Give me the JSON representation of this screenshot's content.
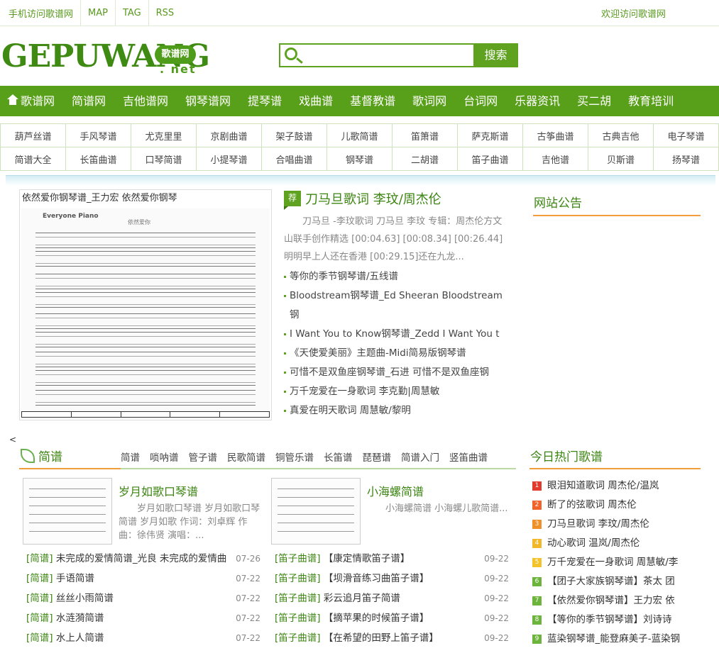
{
  "topbar": {
    "links": [
      "手机访问歌谱网",
      "MAP",
      "TAG",
      "RSS"
    ],
    "welcome": "欢迎访问歌谱网"
  },
  "logo": {
    "letters": "GEPUWANG",
    "badge": "歌谱网",
    "suffix": ". net"
  },
  "search": {
    "placeholder": "",
    "button": "搜索"
  },
  "nav": [
    "歌谱网",
    "简谱网",
    "吉他谱网",
    "钢琴谱网",
    "提琴谱",
    "戏曲谱",
    "基督教谱",
    "歌词网",
    "台词网",
    "乐器资讯",
    "买二胡",
    "教育培训"
  ],
  "subnav": [
    [
      "葫芦丝谱",
      "手风琴谱",
      "尤克里里",
      "京剧曲谱",
      "架子鼓谱",
      "儿歌简谱",
      "笛箫谱",
      "萨克斯谱",
      "古筝曲谱",
      "古典吉他",
      "电子琴谱"
    ],
    [
      "简谱大全",
      "长笛曲谱",
      "口琴简谱",
      "小提琴谱",
      "合唱曲谱",
      "钢琴谱",
      "二胡谱",
      "笛子曲谱",
      "吉他谱",
      "贝斯谱",
      "扬琴谱"
    ]
  ],
  "featured": {
    "caption": "依然爱你钢琴谱_王力宏 依然爱你钢琴",
    "sheet_title": "Everyone Piano",
    "sheet_sub": "依然爱你"
  },
  "lead": {
    "badge": "荐",
    "title": "刀马旦歌词 李玟/周杰伦",
    "desc": "刀马旦 -李玟歌词 刀马旦 李玟 专辑：周杰伦方文山联手创作精选 [00:04.63] [00:08.34] [00:26.44] 明明早上人还在香港 [00:29.15]还在九龙...",
    "items": [
      "等你的季节钢琴谱/五线谱",
      "Bloodstream钢琴谱_Ed Sheeran Bloodstream钢",
      "I Want You to Know钢琴谱_Zedd I Want You t",
      "《天使爱美丽》主题曲-Midi简易版钢琴谱",
      "可惜不是双鱼座钢琴谱_石进 可惜不是双鱼座钢",
      "万千宠爱在一身歌词 李克勤|周慧敏",
      "真爱在明天歌词 周慧敏/黎明"
    ]
  },
  "notice": {
    "title": "网站公告"
  },
  "stray": "<",
  "jianpu": {
    "title": "简谱",
    "tabs": [
      "简谱",
      "唢呐谱",
      "管子谱",
      "民歌简谱",
      "铜管乐谱",
      "长笛谱",
      "琵琶谱",
      "简谱入门",
      "竖笛曲谱"
    ],
    "cards": [
      {
        "title": "岁月如歌口琴谱",
        "desc": "岁月如歌口琴谱 岁月如歌口琴简谱 岁月如歌 作词：刘卓辉 作曲：徐伟贤 演唱：..."
      },
      {
        "title": "小海螺简谱",
        "desc": "小海螺简谱 小海螺儿歌简谱..."
      }
    ],
    "left_list": [
      {
        "cat": "[简谱]",
        "text": "未完成的爱情简谱_光良 未完成的爱情曲",
        "date": "07-26"
      },
      {
        "cat": "[简谱]",
        "text": "手语简谱",
        "date": "07-22"
      },
      {
        "cat": "[简谱]",
        "text": "丝丝小雨简谱",
        "date": "07-22"
      },
      {
        "cat": "[简谱]",
        "text": "水涟漪简谱",
        "date": "07-22"
      },
      {
        "cat": "[简谱]",
        "text": "水上人简谱",
        "date": "07-22"
      }
    ],
    "right_list": [
      {
        "cat": "[笛子曲谱]",
        "text": "【康定情歌笛子谱】",
        "date": "09-22"
      },
      {
        "cat": "[笛子曲谱]",
        "text": "【坝滑音练习曲笛子谱】",
        "date": "09-22"
      },
      {
        "cat": "[笛子曲谱]",
        "text": "彩云追月笛子简谱",
        "date": "09-22"
      },
      {
        "cat": "[笛子曲谱]",
        "text": "【摘苹果的时候笛子谱】",
        "date": "09-22"
      },
      {
        "cat": "[笛子曲谱]",
        "text": "【在希望的田野上笛子谱】",
        "date": "09-22"
      }
    ]
  },
  "hot": {
    "title": "今日热门歌谱",
    "items": [
      {
        "n": "1",
        "text": "眼泪知道歌词 周杰伦/温岚",
        "color": "#e23b2e"
      },
      {
        "n": "2",
        "text": "断了的弦歌词 周杰伦",
        "color": "#f0632b"
      },
      {
        "n": "3",
        "text": "刀马旦歌词 李玟/周杰伦",
        "color": "#f0902b"
      },
      {
        "n": "4",
        "text": "动心歌词 温岚/周杰伦",
        "color": "#f2b72a"
      },
      {
        "n": "5",
        "text": "万千宠爱在一身歌词 周慧敏/李",
        "color": "#f2c32a"
      },
      {
        "n": "6",
        "text": "【团子大家族钢琴谱】茶太 团",
        "color": "#6cb43b"
      },
      {
        "n": "7",
        "text": "【依然爱你钢琴谱】王力宏 依",
        "color": "#6cb43b"
      },
      {
        "n": "8",
        "text": "【等你的季节钢琴谱】刘诗诗",
        "color": "#6cb43b"
      },
      {
        "n": "9",
        "text": "蓝染钢琴谱_能登麻美子-蓝染钢",
        "color": "#6cb43b"
      }
    ]
  }
}
